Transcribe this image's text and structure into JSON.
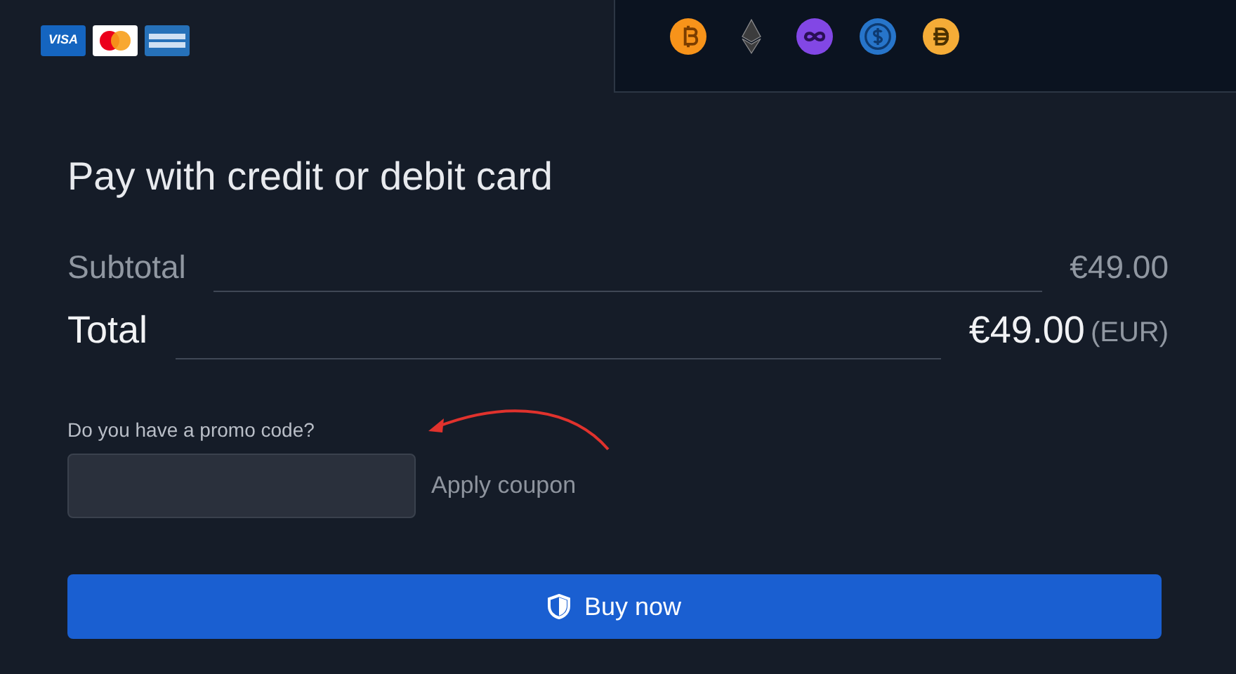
{
  "card_brands": [
    {
      "kind": "visa",
      "label": "VISA"
    },
    {
      "kind": "mastercard"
    },
    {
      "kind": "amex"
    }
  ],
  "crypto_coins": [
    {
      "kind": "bitcoin",
      "color": "#f7931a"
    },
    {
      "kind": "ethereum",
      "color": "#3c3c3d"
    },
    {
      "kind": "polygon",
      "color": "#8247e5"
    },
    {
      "kind": "usdc",
      "color": "#2775ca"
    },
    {
      "kind": "dai",
      "color": "#f5ac37"
    }
  ],
  "heading": "Pay with credit or debit card",
  "summary": [
    {
      "kind": "subtotal",
      "label": "Subtotal",
      "amount": "€49.00"
    },
    {
      "kind": "total",
      "label": "Total",
      "amount": "€49.00",
      "currency": "(EUR)"
    }
  ],
  "promo": {
    "label": "Do you have a promo code?",
    "apply": "Apply coupon"
  },
  "buy_button": {
    "label": "Buy now"
  }
}
